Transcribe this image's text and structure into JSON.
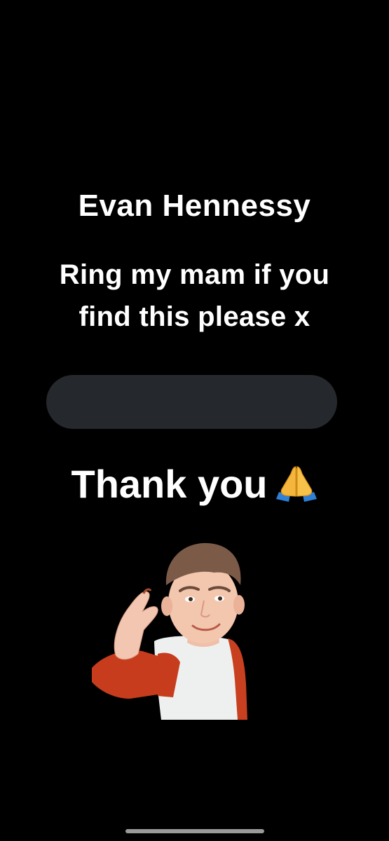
{
  "lock_screen": {
    "name": "Evan Hennessy",
    "message_line1": "Ring my mam if you",
    "message_line2": "find this please x",
    "thanks": "Thank you",
    "thanks_emoji": "folded-hands-icon"
  },
  "colors": {
    "background": "#000000",
    "text": "#ffffff",
    "redacted_bar": "#25282c",
    "home_indicator": "#9a9a9a"
  }
}
